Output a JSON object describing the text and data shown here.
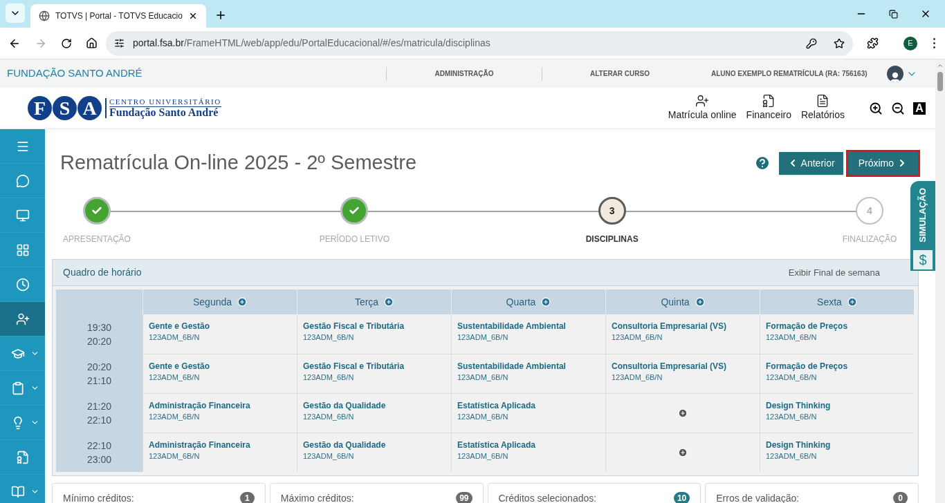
{
  "browser": {
    "tab_title": "TOTVS | Portal - TOTVS Educacio",
    "url_host": "portal.fsa.br",
    "url_path": "/FrameHTML/web/app/edu/PortalEducacional/#/es/matricula/disciplinas",
    "profile": "E"
  },
  "topbar": {
    "brand": "FUNDAÇÃO SANTO ANDRÉ",
    "links": [
      "ADMINISTRAÇÃO",
      "ALTERAR CURSO"
    ],
    "user": "ALUNO EXEMPLO REMATRÍCULA (RA: 756163)"
  },
  "logo": {
    "letters": [
      "F",
      "S",
      "A"
    ],
    "subtitle": "CENTRO UNIVERSITÁRIO",
    "name": "Fundação Santo André"
  },
  "header_nav": [
    {
      "kind": "enroll",
      "label": "Matrícula online"
    },
    {
      "kind": "finance",
      "label": "Financeiro"
    },
    {
      "kind": "reports",
      "label": "Relatórios"
    }
  ],
  "accessibility": {
    "contrast_label": "A"
  },
  "sidebar": {
    "items": [
      {
        "kind": "menu",
        "selected": false,
        "expandable": false
      },
      {
        "kind": "chat",
        "selected": false,
        "expandable": false
      },
      {
        "kind": "monitor",
        "selected": false,
        "expandable": false
      },
      {
        "kind": "grid",
        "selected": false,
        "expandable": false
      },
      {
        "kind": "clock",
        "selected": false,
        "expandable": false
      },
      {
        "kind": "enroll",
        "selected": true,
        "expandable": false
      },
      {
        "kind": "cap",
        "selected": false,
        "expandable": true
      },
      {
        "kind": "clipboard",
        "selected": false,
        "expandable": true
      },
      {
        "kind": "bulb",
        "selected": false,
        "expandable": true
      },
      {
        "kind": "finance",
        "selected": false,
        "expandable": false
      },
      {
        "kind": "book",
        "selected": false,
        "expandable": true
      }
    ]
  },
  "page": {
    "title": "Rematrícula On-line 2025 - 2º Semestre",
    "prev_button": "Anterior",
    "next_button": "Próximo",
    "next_highlighted": true
  },
  "steps": [
    {
      "label": "APRESENTAÇÃO",
      "done": true,
      "current": false
    },
    {
      "label": "PERÍODO LETIVO",
      "done": true,
      "current": false
    },
    {
      "label": "DISCIPLINAS",
      "number": "3",
      "done": false,
      "current": true
    },
    {
      "label": "FINALIZAÇÃO",
      "number": "4",
      "done": false,
      "current": false
    }
  ],
  "simulation_tab": {
    "label": "SIMULAÇÃO",
    "symbol": "$"
  },
  "schedule": {
    "title": "Quadro de horário",
    "weekend_toggle": "Exibir Final de semana",
    "columns": [
      "Segunda",
      "Terça",
      "Quarta",
      "Quinta",
      "Sexta"
    ],
    "rows": [
      {
        "start": "19:30",
        "end": "20:20",
        "cells": [
          {
            "kind": "course",
            "name": "Gente e Gestão",
            "code": "123ADM_6B/N"
          },
          {
            "kind": "course",
            "name": "Gestão Fiscal e Tributária",
            "code": "123ADM_6B/N"
          },
          {
            "kind": "course",
            "name": "Sustentabilidade Ambiental",
            "code": "123ADM_6B/N"
          },
          {
            "kind": "course",
            "name": "Consultoria Empresarial (VS)",
            "code": "123ADM_6B/N"
          },
          {
            "kind": "course",
            "name": "Formação de Preços",
            "code": "123ADM_6B/N"
          }
        ]
      },
      {
        "start": "20:20",
        "end": "21:10",
        "cells": [
          {
            "kind": "course",
            "name": "Gente e Gestão",
            "code": "123ADM_6B/N"
          },
          {
            "kind": "course",
            "name": "Gestão Fiscal e Tributária",
            "code": "123ADM_6B/N"
          },
          {
            "kind": "course",
            "name": "Sustentabilidade Ambiental",
            "code": "123ADM_6B/N"
          },
          {
            "kind": "course",
            "name": "Consultoria Empresarial (VS)",
            "code": "123ADM_6B/N"
          },
          {
            "kind": "course",
            "name": "Formação de Preços",
            "code": "123ADM_6B/N"
          }
        ]
      },
      {
        "start": "21:20",
        "end": "22:10",
        "cells": [
          {
            "kind": "course",
            "name": "Administração Financeira",
            "code": "123ADM_6B/N"
          },
          {
            "kind": "course",
            "name": "Gestão da Qualidade",
            "code": "123ADM_6B/N"
          },
          {
            "kind": "course",
            "name": "Estatística Aplicada",
            "code": "123ADM_6B/N"
          },
          {
            "kind": "empty"
          },
          {
            "kind": "course",
            "name": "Design Thinking",
            "code": "123ADM_6B/N"
          }
        ]
      },
      {
        "start": "22:10",
        "end": "23:00",
        "cells": [
          {
            "kind": "course",
            "name": "Administração Financeira",
            "code": "123ADM_6B/N"
          },
          {
            "kind": "course",
            "name": "Gestão da Qualidade",
            "code": "123ADM_6B/N"
          },
          {
            "kind": "course",
            "name": "Estatística Aplicada",
            "code": "123ADM_6B/N"
          },
          {
            "kind": "empty"
          },
          {
            "kind": "course",
            "name": "Design Thinking",
            "code": "123ADM_6B/N"
          }
        ]
      }
    ]
  },
  "credits": [
    {
      "label": "Mínimo créditos:",
      "count": "1",
      "color": "#6b6b6b"
    },
    {
      "label": "Máximo créditos:",
      "count": "99",
      "color": "#6b6b6b"
    },
    {
      "label": "Créditos selecionados:",
      "count": "10",
      "color": "#227a86"
    },
    {
      "label": "Erros de validação:",
      "count": "0",
      "color": "#6b6b6b"
    }
  ]
}
